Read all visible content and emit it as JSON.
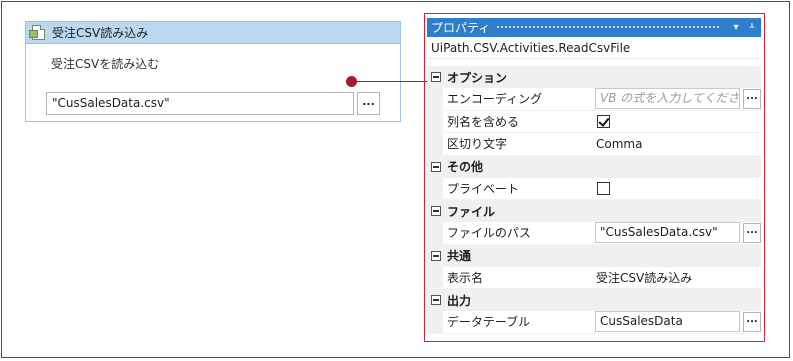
{
  "activity": {
    "title": "受注CSV読み込み",
    "description": "受注CSVを読み込む",
    "file_path": "\"CusSalesData.csv\"",
    "browse_label": "..."
  },
  "properties": {
    "panel_title": "プロパティ",
    "dropdown_label": "▾",
    "pin_label": "ᚆ",
    "activity_type": "UiPath.CSV.Activities.ReadCsvFile",
    "categories": [
      {
        "name": "オプション",
        "rows": [
          {
            "name": "エンコーディング",
            "kind": "input",
            "value": "VB の式を入力してください",
            "placeholder": true
          },
          {
            "name": "列名を含める",
            "kind": "checkbox",
            "checked": true
          },
          {
            "name": "区切り文字",
            "kind": "text",
            "value": "Comma"
          }
        ]
      },
      {
        "name": "その他",
        "rows": [
          {
            "name": "プライベート",
            "kind": "checkbox",
            "checked": false
          }
        ]
      },
      {
        "name": "ファイル",
        "rows": [
          {
            "name": "ファイルのパス",
            "kind": "input",
            "value": "\"CusSalesData.csv\"",
            "placeholder": false
          }
        ]
      },
      {
        "name": "共通",
        "rows": [
          {
            "name": "表示名",
            "kind": "text",
            "value": "受注CSV読み込み"
          }
        ]
      },
      {
        "name": "出力",
        "rows": [
          {
            "name": "データテーブル",
            "kind": "input",
            "value": "CusSalesData",
            "placeholder": false
          }
        ]
      }
    ],
    "browse_label": "..."
  },
  "colors": {
    "highlight": "#c42b33",
    "header_blue": "#2f7dcd",
    "activity_header": "#bcd8f1"
  }
}
